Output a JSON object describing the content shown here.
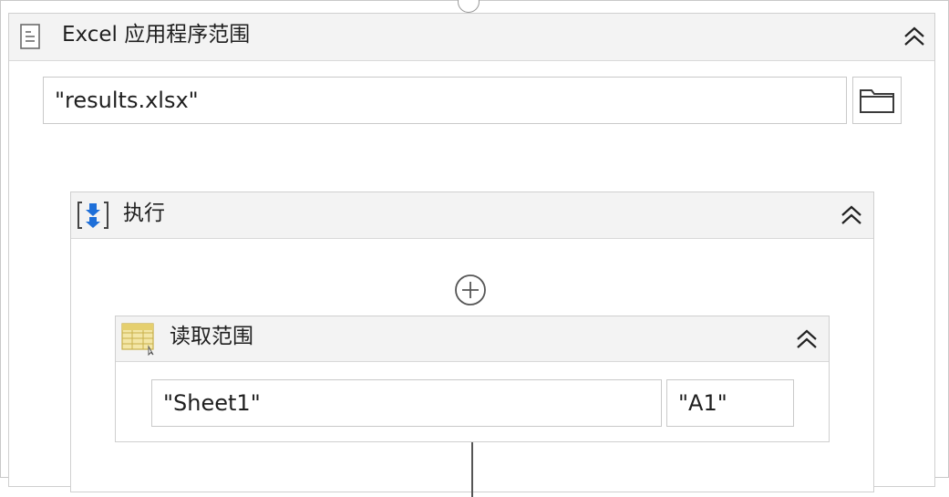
{
  "excel_scope": {
    "title": "Excel 应用程序范围",
    "icon": "document-icon",
    "collapse_icon": "double-chevron-up-icon",
    "workbook_path": "\"results.xlsx\"",
    "browse_icon": "folder-icon"
  },
  "do_sequence": {
    "title": "执行",
    "icon": "sequence-icon",
    "collapse_icon": "double-chevron-up-icon",
    "add_icon": "add-activity-icon"
  },
  "read_range": {
    "title": "读取范围",
    "icon": "excel-read-range-icon",
    "collapse_icon": "double-chevron-up-icon",
    "sheet_name": "\"Sheet1\"",
    "range": "\"A1\""
  },
  "colors": {
    "header_bg": "#f3f3f3",
    "border": "#cfcfcf",
    "accent_blue": "#1e6fd9"
  }
}
